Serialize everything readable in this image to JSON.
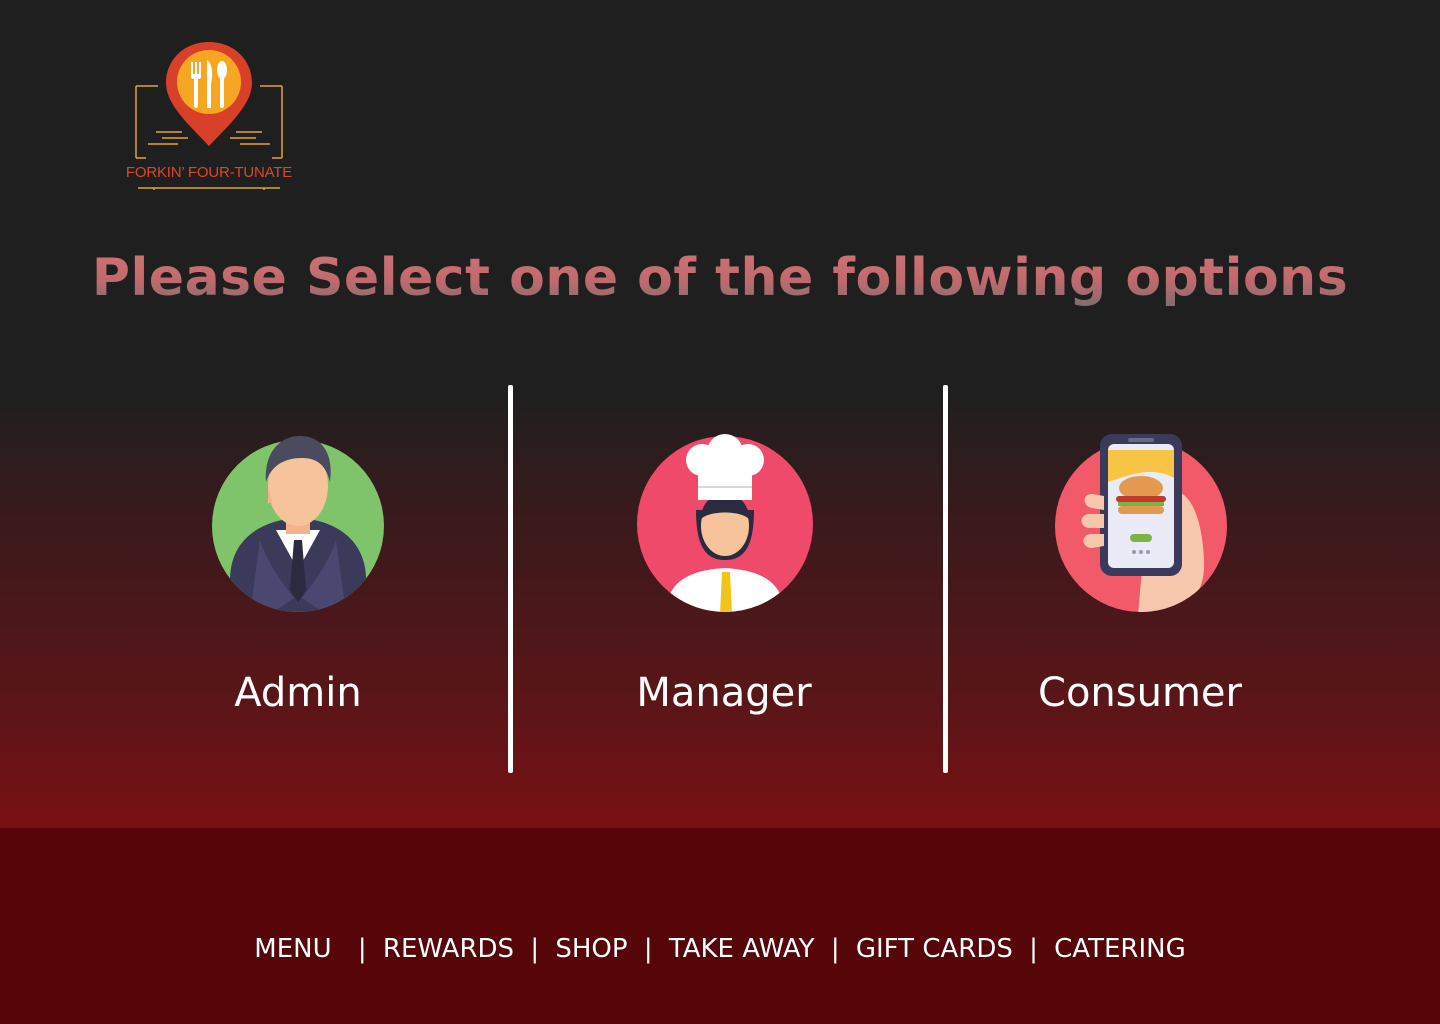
{
  "brand": {
    "name": "FORKIN’ FOUR-TUNATE",
    "logo_icon": "map-pin-fork-knife-spoon",
    "accent": "#d9482b"
  },
  "heading": "Please Select one of the following options",
  "roles": [
    {
      "label": "Admin",
      "icon": "businessman-avatar",
      "circle_color": "#7fc46a"
    },
    {
      "label": "Manager",
      "icon": "chef-avatar",
      "circle_color": "#ef4a6a"
    },
    {
      "label": "Consumer",
      "icon": "phone-burger-order",
      "circle_color": "#f25a6a"
    }
  ],
  "footer": {
    "links": [
      "MENU",
      "REWARDS",
      "SHOP",
      "TAKE AWAY",
      "GIFT CARDS",
      "CATERING"
    ],
    "separator": "|"
  },
  "colors": {
    "footer_bg": "#560508",
    "top_bg": "#1f1f1f",
    "heading": "#c06a6d"
  }
}
